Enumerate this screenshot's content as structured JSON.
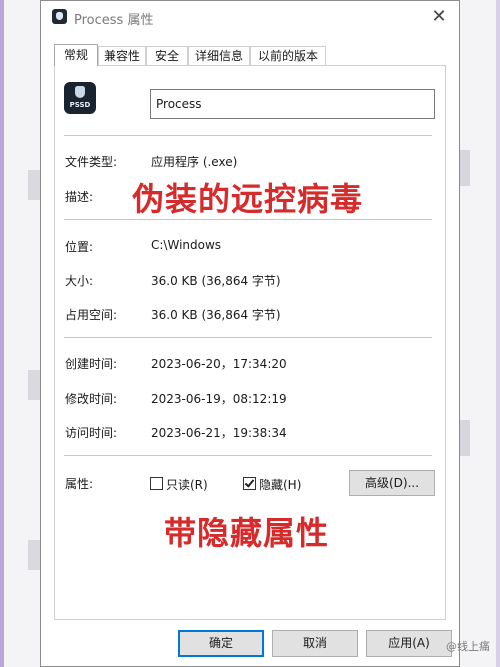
{
  "dialog": {
    "title": "Process 属性",
    "close_glyph": "✕"
  },
  "tabs": [
    {
      "label": "常规",
      "active": true
    },
    {
      "label": "兼容性",
      "active": false
    },
    {
      "label": "安全",
      "active": false
    },
    {
      "label": "详细信息",
      "active": false
    },
    {
      "label": "以前的版本",
      "active": false
    }
  ],
  "general": {
    "icon_text": "PSSD",
    "file_name": "Process",
    "file_type_label": "文件类型:",
    "file_type_value": "应用程序 (.exe)",
    "description_label": "描述:",
    "location_label": "位置:",
    "location_value": "C:\\Windows",
    "size_label": "大小:",
    "size_value": "36.0 KB (36,864 字节)",
    "size_on_disk_label": "占用空间:",
    "size_on_disk_value": "36.0 KB (36,864 字节)",
    "created_label": "创建时间:",
    "created_value": "2023-06-20，17:34:20",
    "modified_label": "修改时间:",
    "modified_value": "2023-06-19，08:12:19",
    "accessed_label": "访问时间:",
    "accessed_value": "2023-06-21，19:38:34",
    "attributes_label": "属性:",
    "readonly_label": "只读(R)",
    "readonly_checked": false,
    "hidden_label": "隐藏(H)",
    "hidden_checked": true,
    "advanced_button": "高级(D)..."
  },
  "annotations": {
    "top": "伪装的远控病毒",
    "bottom": "带隐藏属性"
  },
  "buttons": {
    "ok": "确定",
    "cancel": "取消",
    "apply": "应用(A)"
  },
  "watermark": "@线上痛",
  "colors": {
    "annotation": "#d72a2a",
    "primary_border": "#0078d7"
  }
}
